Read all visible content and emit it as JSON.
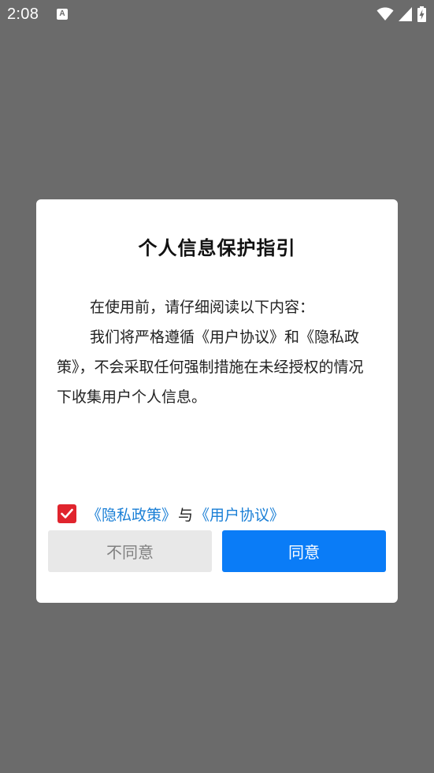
{
  "status_bar": {
    "time": "2:08",
    "notification_glyph": "A",
    "icons": [
      "wifi-icon",
      "signal-icon",
      "battery-charging-icon"
    ]
  },
  "dialog": {
    "title": "个人信息保护指引",
    "paragraphs": [
      "在使用前，请仔细阅读以下内容：",
      "我们将严格遵循《用户协议》和《隐私政策》，不会采取任何强制措施在未经授权的情况下收集用户个人信息。"
    ],
    "consent": {
      "checked": true,
      "privacy_link": "《隐私政策》",
      "separator": "与",
      "terms_link": "《用户协议》"
    },
    "buttons": {
      "decline": "不同意",
      "agree": "同意"
    }
  },
  "colors": {
    "overlay": "#6b6b6b",
    "accent": "#0a7cf7",
    "link": "#1a7fd6",
    "checkbox": "#e0242d",
    "decline_bg": "#e8e8e8"
  }
}
